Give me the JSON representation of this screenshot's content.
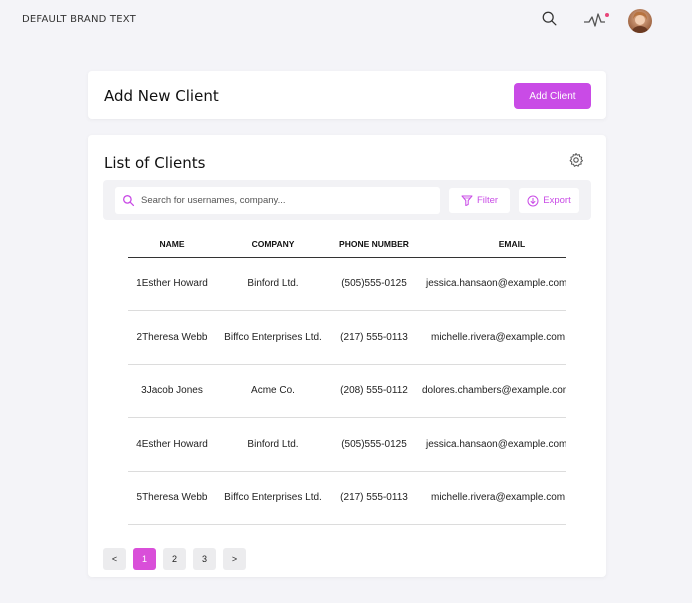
{
  "brand": "DEFAULT BRAND TEXT",
  "header": {
    "search_icon": "search-icon",
    "activity_icon": "activity-icon",
    "notification_color": "#e8457a"
  },
  "add_card": {
    "title": "Add New Client",
    "button_label": "Add Client"
  },
  "list_card": {
    "title": "List of Clients",
    "search_placeholder": "Search for usernames, company...",
    "filter_label": "Filter",
    "export_label": "Export",
    "columns": [
      "NAME",
      "COMPANY",
      "PHONE NUMBER",
      "EMAIL"
    ],
    "rows": [
      {
        "name": "1Esther Howard",
        "company": "Binford Ltd.",
        "phone": "(505)555-0125",
        "email": "jessica.hansaon@example.com"
      },
      {
        "name": "2Theresa Webb",
        "company": "Biffco Enterprises Ltd.",
        "phone": "(217) 555-0113",
        "email": "michelle.rivera@example.com"
      },
      {
        "name": "3Jacob Jones",
        "company": "Acme Co.",
        "phone": "(208) 555-0112",
        "email": "dolores.chambers@example.com"
      },
      {
        "name": "4Esther Howard",
        "company": "Binford Ltd.",
        "phone": "(505)555-0125",
        "email": "jessica.hansaon@example.com"
      },
      {
        "name": "5Theresa Webb",
        "company": "Biffco Enterprises Ltd.",
        "phone": "(217) 555-0113",
        "email": "michelle.rivera@example.com"
      }
    ]
  },
  "pagination": {
    "prev": "<",
    "pages": [
      "1",
      "2",
      "3"
    ],
    "next": ">",
    "current": "1"
  },
  "colors": {
    "accent": "#c94be6",
    "active_page": "#d94fd9",
    "background": "#f4f4f8"
  }
}
